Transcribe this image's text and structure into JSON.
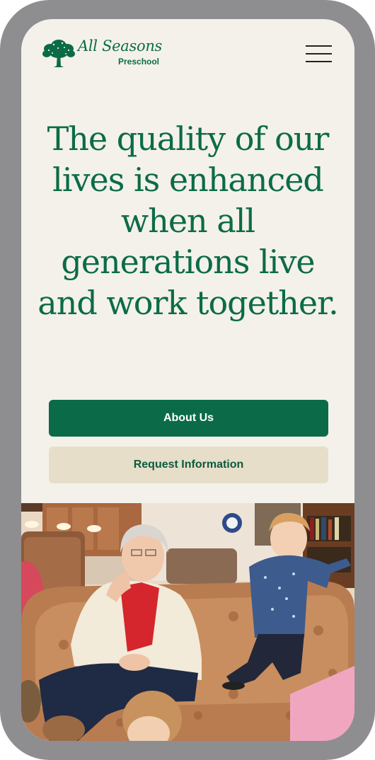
{
  "header": {
    "logo_name": "All Seasons",
    "logo_subtitle": "Preschool",
    "logo_icon": "tree-icon",
    "menu_icon": "hamburger-menu-icon"
  },
  "hero": {
    "headline": "The quality of our lives is enhanced when all generations live and work together."
  },
  "buttons": {
    "about_label": "About Us",
    "request_label": "Request Information"
  },
  "photo": {
    "subject": "elderly woman and young child on patterned sofa"
  },
  "colors": {
    "brand_green": "#0b6b48",
    "background": "#f3f1ea",
    "secondary_button": "#e6dec9",
    "device_frame": "#8e8e90"
  }
}
